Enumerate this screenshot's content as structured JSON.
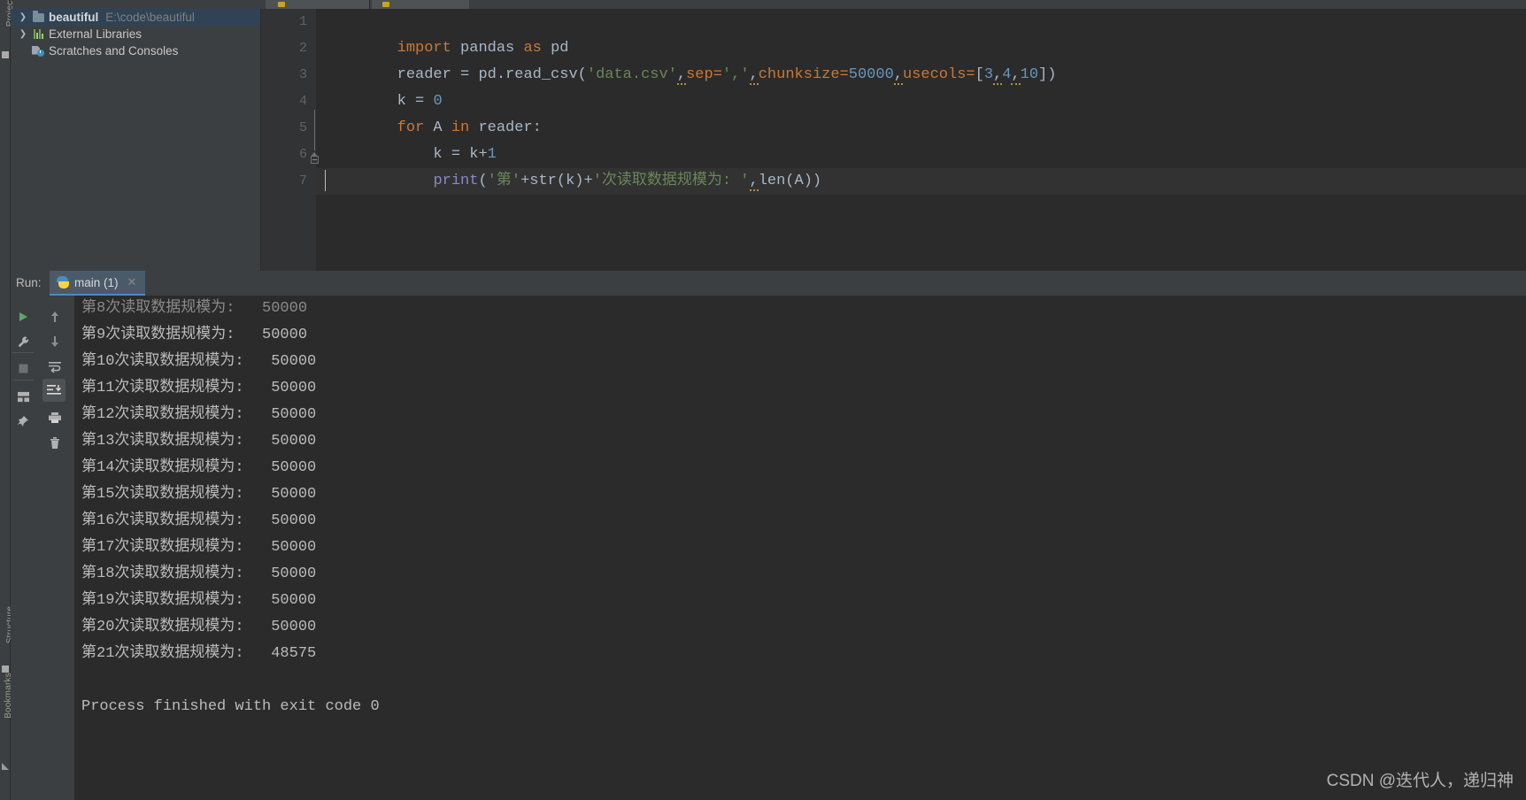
{
  "window": {
    "theme_bg": "#3c3f41",
    "editor_bg": "#2b2b2b",
    "accent": "#4a88c7"
  },
  "left_rail": {
    "project_label": "Project",
    "structure_label": "Structure",
    "bookmarks_label": "Bookmarks"
  },
  "project_panel": {
    "items": [
      {
        "name": "beautiful",
        "path": "E:\\code\\beautiful",
        "icon": "folder-icon",
        "expandable": true,
        "selected": true
      },
      {
        "name": "External Libraries",
        "path": "",
        "icon": "library-icon",
        "expandable": true,
        "selected": false
      },
      {
        "name": "Scratches and Consoles",
        "path": "",
        "icon": "scratches-icon",
        "expandable": false,
        "selected": false
      }
    ]
  },
  "editor": {
    "line_numbers": [
      "1",
      "2",
      "3",
      "4",
      "5",
      "6",
      "7"
    ],
    "lines": [
      {
        "n": 1,
        "tokens": [
          {
            "t": "import",
            "c": "kw"
          },
          {
            "t": " pandas ",
            "c": "plain"
          },
          {
            "t": "as",
            "c": "kw"
          },
          {
            "t": " pd",
            "c": "plain"
          }
        ]
      },
      {
        "n": 2,
        "tokens": [
          {
            "t": "reader = pd.read_csv(",
            "c": "plain"
          },
          {
            "t": "'data.csv'",
            "c": "str"
          },
          {
            "t": ",",
            "c": "warn"
          },
          {
            "t": "sep=",
            "c": "param"
          },
          {
            "t": "','",
            "c": "str"
          },
          {
            "t": ",",
            "c": "warn"
          },
          {
            "t": "chunksize=",
            "c": "param"
          },
          {
            "t": "50000",
            "c": "num"
          },
          {
            "t": ",",
            "c": "warn"
          },
          {
            "t": "usecols=",
            "c": "param"
          },
          {
            "t": "[",
            "c": "plain"
          },
          {
            "t": "3",
            "c": "num"
          },
          {
            "t": ",",
            "c": "warn"
          },
          {
            "t": "4",
            "c": "num"
          },
          {
            "t": ",",
            "c": "warn"
          },
          {
            "t": "10",
            "c": "num"
          },
          {
            "t": "])",
            "c": "plain"
          }
        ]
      },
      {
        "n": 3,
        "tokens": [
          {
            "t": "k = ",
            "c": "plain"
          },
          {
            "t": "0",
            "c": "num"
          }
        ]
      },
      {
        "n": 4,
        "tokens": [
          {
            "t": "for",
            "c": "kw"
          },
          {
            "t": " A ",
            "c": "plain"
          },
          {
            "t": "in",
            "c": "kw"
          },
          {
            "t": " reader:",
            "c": "plain"
          }
        ]
      },
      {
        "n": 5,
        "tokens": [
          {
            "t": "    k = k+",
            "c": "plain"
          },
          {
            "t": "1",
            "c": "num"
          }
        ]
      },
      {
        "n": 6,
        "tokens": [
          {
            "t": "    ",
            "c": "plain"
          },
          {
            "t": "print",
            "c": "builtin"
          },
          {
            "t": "(",
            "c": "plain"
          },
          {
            "t": "'第'",
            "c": "str"
          },
          {
            "t": "+str(k)+",
            "c": "plain"
          },
          {
            "t": "'次读取数据规模为: '",
            "c": "str"
          },
          {
            "t": ",",
            "c": "warn"
          },
          {
            "t": "len(A))",
            "c": "plain"
          }
        ]
      },
      {
        "n": 7,
        "tokens": [
          {
            "t": "",
            "c": "plain"
          }
        ]
      }
    ]
  },
  "run_panel": {
    "label": "Run:",
    "tab_title": "main (1)",
    "tab_icon": "python-icon",
    "close_icon": "close-icon",
    "toolbar": [
      {
        "name": "rerun-button",
        "icon": "play-icon"
      },
      {
        "name": "scroll-up-button",
        "icon": "arrow-up-icon"
      },
      {
        "name": "settings-button",
        "icon": "wrench-icon"
      },
      {
        "name": "scroll-down-button",
        "icon": "arrow-down-icon"
      },
      {
        "name": "stop-button",
        "icon": "stop-square-icon"
      },
      {
        "name": "soft-wrap-button",
        "icon": "wrap-lines-icon"
      },
      {
        "name": "scroll-to-end-button",
        "icon": "scroll-end-icon"
      },
      {
        "name": "layout-button",
        "icon": "layout-icon"
      },
      {
        "name": "print-button",
        "icon": "printer-icon"
      },
      {
        "name": "pin-button",
        "icon": "pin-icon"
      },
      {
        "name": "clear-all-button",
        "icon": "trash-icon"
      }
    ],
    "console_lines": [
      {
        "text": "第8次读取数据规模为:   50000",
        "clipped": true
      },
      {
        "text": "第9次读取数据规模为:   50000",
        "clipped": false
      },
      {
        "text": "第10次读取数据规模为:   50000",
        "clipped": false
      },
      {
        "text": "第11次读取数据规模为:   50000",
        "clipped": false
      },
      {
        "text": "第12次读取数据规模为:   50000",
        "clipped": false
      },
      {
        "text": "第13次读取数据规模为:   50000",
        "clipped": false
      },
      {
        "text": "第14次读取数据规模为:   50000",
        "clipped": false
      },
      {
        "text": "第15次读取数据规模为:   50000",
        "clipped": false
      },
      {
        "text": "第16次读取数据规模为:   50000",
        "clipped": false
      },
      {
        "text": "第17次读取数据规模为:   50000",
        "clipped": false
      },
      {
        "text": "第18次读取数据规模为:   50000",
        "clipped": false
      },
      {
        "text": "第19次读取数据规模为:   50000",
        "clipped": false
      },
      {
        "text": "第20次读取数据规模为:   50000",
        "clipped": false
      },
      {
        "text": "第21次读取数据规模为:   48575",
        "clipped": false
      },
      {
        "text": "",
        "clipped": false
      },
      {
        "text": "Process finished with exit code 0",
        "clipped": false
      }
    ]
  },
  "watermark": {
    "text": "CSDN @迭代人，递归神"
  }
}
